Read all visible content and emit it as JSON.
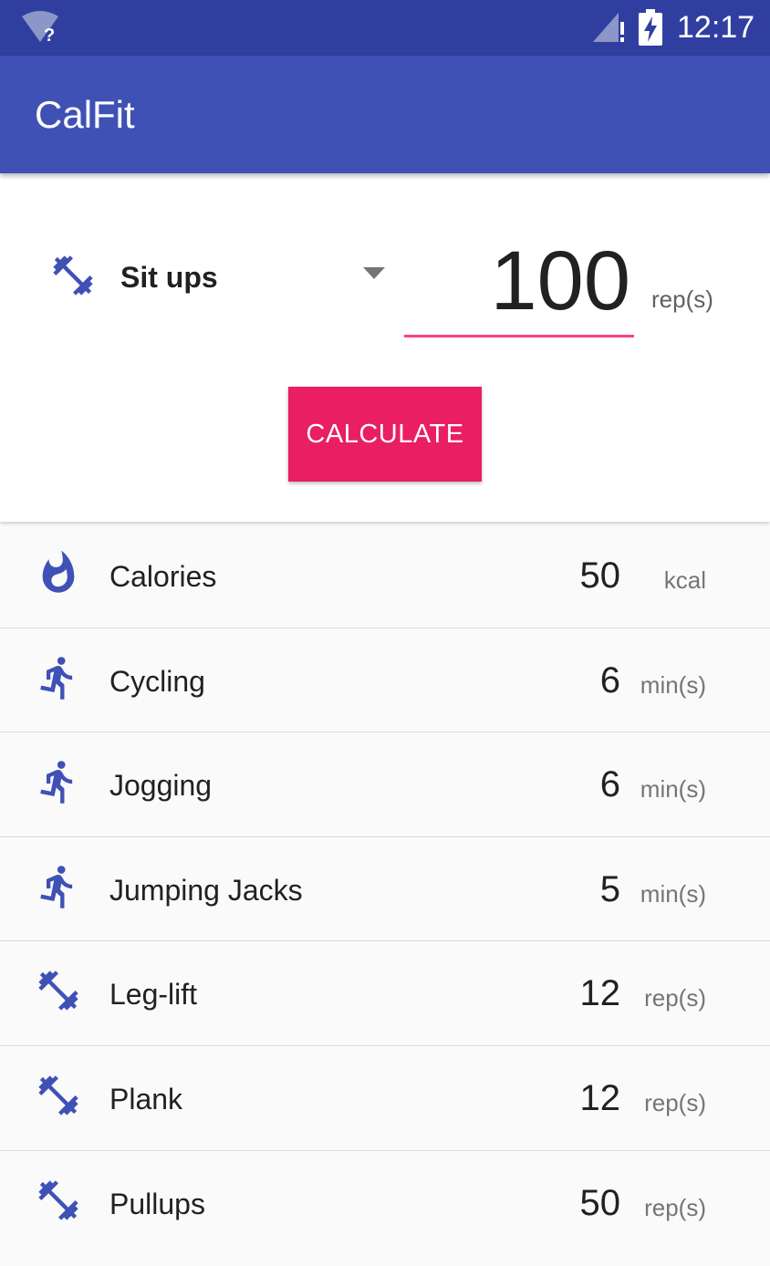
{
  "status_bar": {
    "time": "12:17",
    "wifi_badge": "?"
  },
  "app_bar": {
    "title": "CalFit"
  },
  "input": {
    "exercise": "Sit ups",
    "exercise_icon": "dumbbell-icon",
    "reps_value": "100",
    "reps_unit": "rep(s)",
    "button_label": "CALCULATE"
  },
  "colors": {
    "primary": "#3f51b5",
    "primary_dark": "#303f9f",
    "accent": "#e91e63",
    "underline": "#ff4081"
  },
  "results": [
    {
      "icon": "flame-icon",
      "label": "Calories",
      "value": "50",
      "unit": "kcal"
    },
    {
      "icon": "runner-icon",
      "label": "Cycling",
      "value": "6",
      "unit": "min(s)"
    },
    {
      "icon": "runner-icon",
      "label": "Jogging",
      "value": "6",
      "unit": "min(s)"
    },
    {
      "icon": "runner-icon",
      "label": "Jumping Jacks",
      "value": "5",
      "unit": "min(s)"
    },
    {
      "icon": "dumbbell-icon",
      "label": "Leg-lift",
      "value": "12",
      "unit": "rep(s)"
    },
    {
      "icon": "dumbbell-icon",
      "label": "Plank",
      "value": "12",
      "unit": "rep(s)"
    },
    {
      "icon": "dumbbell-icon",
      "label": "Pullups",
      "value": "50",
      "unit": "rep(s)"
    }
  ]
}
